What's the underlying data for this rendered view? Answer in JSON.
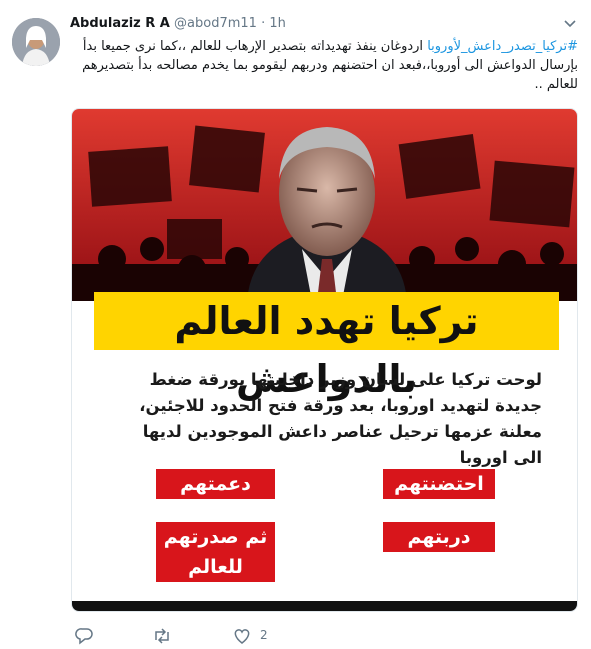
{
  "tweet": {
    "author_name": "Abdulaziz R A",
    "author_handle": "@abod7m11",
    "separator": "·",
    "time_ago": "1h",
    "hashtag": "#تركيا_تصدر_داعش_لأوروبا",
    "text": " اردوغان ينفذ تهديداته بتصدير الإرهاب للعالم ،،كما نرى جميعا بدأ بإرسال الدواعش الى أوروبا،،فبعد ان احتضنهم ودربهم ليقومو بما يخدم مصالحه بدأ بتصديرهم للعالم .."
  },
  "card": {
    "headline": "تركيا تهدد العالم بالدواعش",
    "body": "لوحت تركيا على لسان وزير داخليتها بورقة ضغط جديدة لتهديد اوروبا، بعد ورقة فتح الحدود للاجئين، معلنة عزمها ترحيل عناصر داعش الموجودين لديها الى اوروبا",
    "tags": {
      "embraced": "احتضنتهم",
      "supported": "دعمتهم",
      "trained": "دربتهم",
      "exported_1": "ثم صدرتهم",
      "exported_2": "للعالم"
    }
  },
  "actions": {
    "like_count": "2"
  },
  "colors": {
    "hashtag": "#1b95e0",
    "headline_bg": "#ffd400",
    "tag_bg": "#d8151b",
    "hero_red": "#c8181e",
    "icon_gray": "#657786"
  }
}
